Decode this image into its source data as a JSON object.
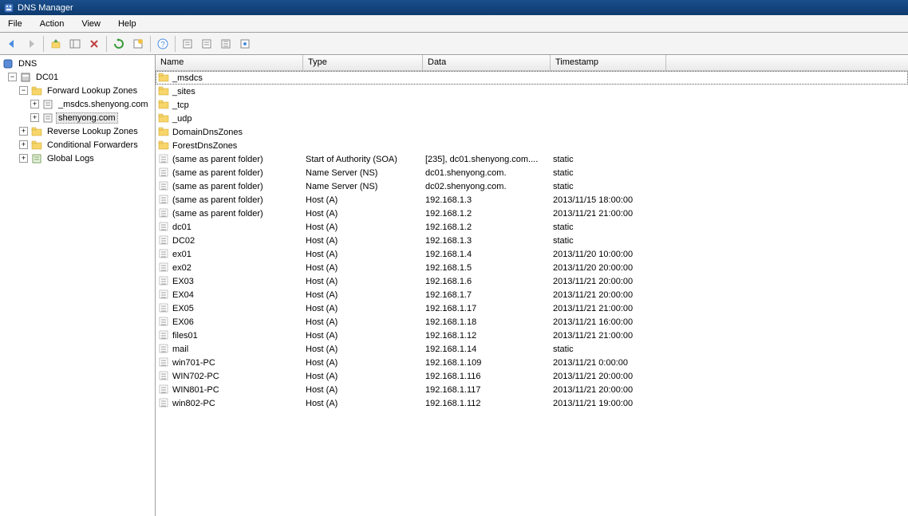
{
  "titlebar": {
    "text": "DNS Manager"
  },
  "menu": {
    "file": "File",
    "action": "Action",
    "view": "View",
    "help": "Help"
  },
  "tree": {
    "root": "DNS",
    "server": "DC01",
    "flz": "Forward Lookup Zones",
    "flz_items": [
      "_msdcs.shenyong.com",
      "shenyong.com"
    ],
    "rlz": "Reverse Lookup Zones",
    "cf": "Conditional Forwarders",
    "gl": "Global Logs"
  },
  "columns": {
    "name": "Name",
    "type": "Type",
    "data": "Data",
    "timestamp": "Timestamp"
  },
  "folders": [
    "_msdcs",
    "_sites",
    "_tcp",
    "_udp",
    "DomainDnsZones",
    "ForestDnsZones"
  ],
  "records": [
    {
      "name": "(same as parent folder)",
      "type": "Start of Authority (SOA)",
      "data": "[235], dc01.shenyong.com....",
      "ts": "static"
    },
    {
      "name": "(same as parent folder)",
      "type": "Name Server (NS)",
      "data": "dc01.shenyong.com.",
      "ts": "static"
    },
    {
      "name": "(same as parent folder)",
      "type": "Name Server (NS)",
      "data": "dc02.shenyong.com.",
      "ts": "static"
    },
    {
      "name": "(same as parent folder)",
      "type": "Host (A)",
      "data": "192.168.1.3",
      "ts": "2013/11/15 18:00:00"
    },
    {
      "name": "(same as parent folder)",
      "type": "Host (A)",
      "data": "192.168.1.2",
      "ts": "2013/11/21 21:00:00"
    },
    {
      "name": "dc01",
      "type": "Host (A)",
      "data": "192.168.1.2",
      "ts": "static"
    },
    {
      "name": "DC02",
      "type": "Host (A)",
      "data": "192.168.1.3",
      "ts": "static"
    },
    {
      "name": "ex01",
      "type": "Host (A)",
      "data": "192.168.1.4",
      "ts": "2013/11/20 10:00:00"
    },
    {
      "name": "ex02",
      "type": "Host (A)",
      "data": "192.168.1.5",
      "ts": "2013/11/20 20:00:00"
    },
    {
      "name": "EX03",
      "type": "Host (A)",
      "data": "192.168.1.6",
      "ts": "2013/11/21 20:00:00"
    },
    {
      "name": "EX04",
      "type": "Host (A)",
      "data": "192.168.1.7",
      "ts": "2013/11/21 20:00:00"
    },
    {
      "name": "EX05",
      "type": "Host (A)",
      "data": "192.168.1.17",
      "ts": "2013/11/21 21:00:00"
    },
    {
      "name": "EX06",
      "type": "Host (A)",
      "data": "192.168.1.18",
      "ts": "2013/11/21 16:00:00"
    },
    {
      "name": "files01",
      "type": "Host (A)",
      "data": "192.168.1.12",
      "ts": "2013/11/21 21:00:00"
    },
    {
      "name": "mail",
      "type": "Host (A)",
      "data": "192.168.1.14",
      "ts": "static"
    },
    {
      "name": "win701-PC",
      "type": "Host (A)",
      "data": "192.168.1.109",
      "ts": "2013/11/21 0:00:00"
    },
    {
      "name": "WIN702-PC",
      "type": "Host (A)",
      "data": "192.168.1.116",
      "ts": "2013/11/21 20:00:00"
    },
    {
      "name": "WIN801-PC",
      "type": "Host (A)",
      "data": "192.168.1.117",
      "ts": "2013/11/21 20:00:00"
    },
    {
      "name": "win802-PC",
      "type": "Host (A)",
      "data": "192.168.1.112",
      "ts": "2013/11/21 19:00:00"
    }
  ]
}
